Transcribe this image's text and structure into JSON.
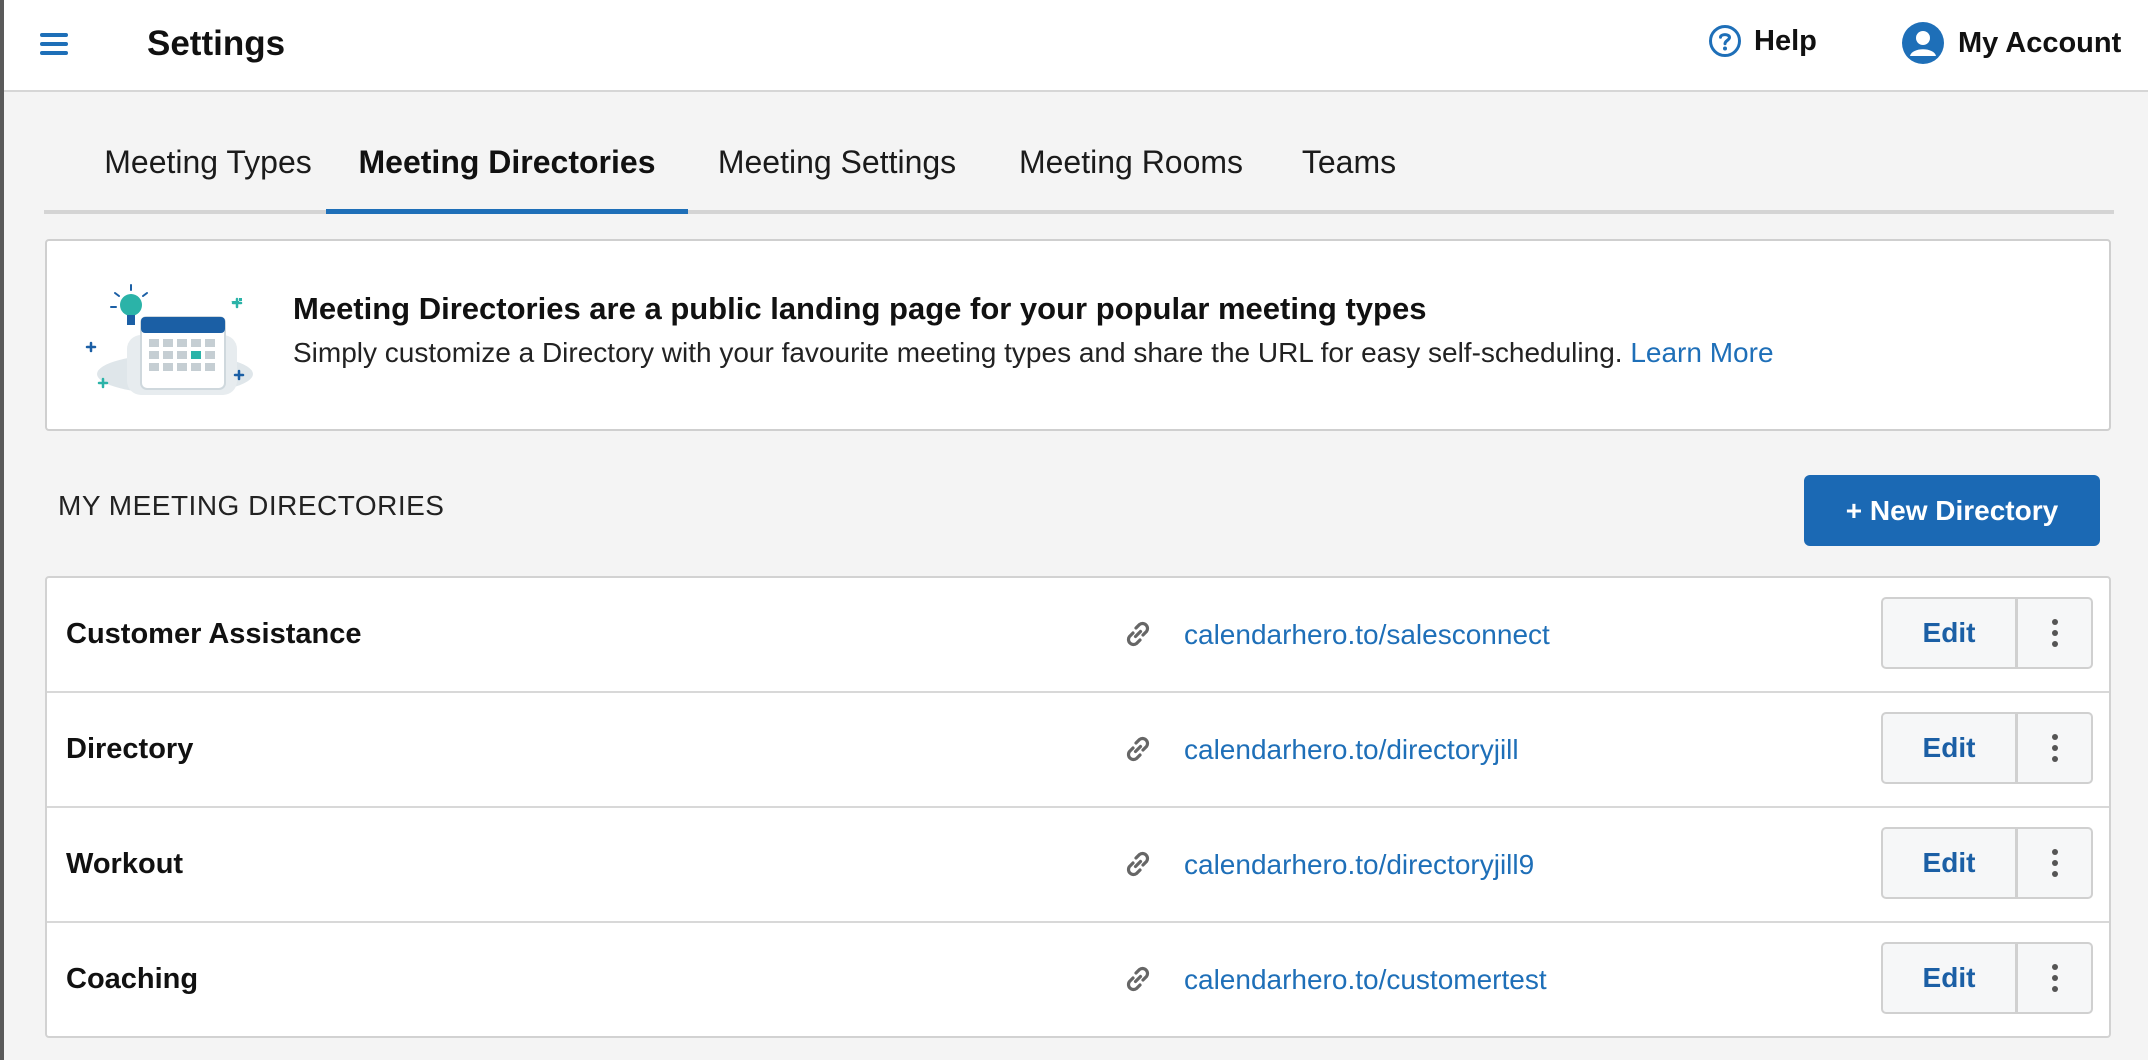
{
  "header": {
    "title": "Settings",
    "help_label": "Help",
    "account_label": "My Account"
  },
  "tabs": [
    {
      "label": "Meeting Types",
      "active": false
    },
    {
      "label": "Meeting Directories",
      "active": true
    },
    {
      "label": "Meeting Settings",
      "active": false
    },
    {
      "label": "Meeting Rooms",
      "active": false
    },
    {
      "label": "Teams",
      "active": false
    }
  ],
  "banner": {
    "heading": "Meeting Directories are a public landing page for your popular meeting types",
    "body": "Simply customize a Directory with your favourite meeting types and share the URL for easy self-scheduling.",
    "link_label": "Learn More"
  },
  "section": {
    "title": "MY MEETING DIRECTORIES",
    "new_button_label": "+ New Directory"
  },
  "directories": [
    {
      "name": "Customer Assistance",
      "url": "calendarhero.to/salesconnect",
      "edit_label": "Edit"
    },
    {
      "name": "Directory",
      "url": "calendarhero.to/directoryjill",
      "edit_label": "Edit"
    },
    {
      "name": "Workout",
      "url": "calendarhero.to/directoryjill9",
      "edit_label": "Edit"
    },
    {
      "name": "Coaching",
      "url": "calendarhero.to/customertest",
      "edit_label": "Edit"
    }
  ],
  "colors": {
    "accent": "#1e6fb8",
    "button_primary": "#1b69b4",
    "background": "#f4f4f4"
  },
  "icons": {
    "menu": "hamburger-menu-icon",
    "help": "question-circle-icon",
    "account": "user-avatar-icon",
    "link": "chain-link-icon",
    "more": "vertical-dots-icon"
  }
}
